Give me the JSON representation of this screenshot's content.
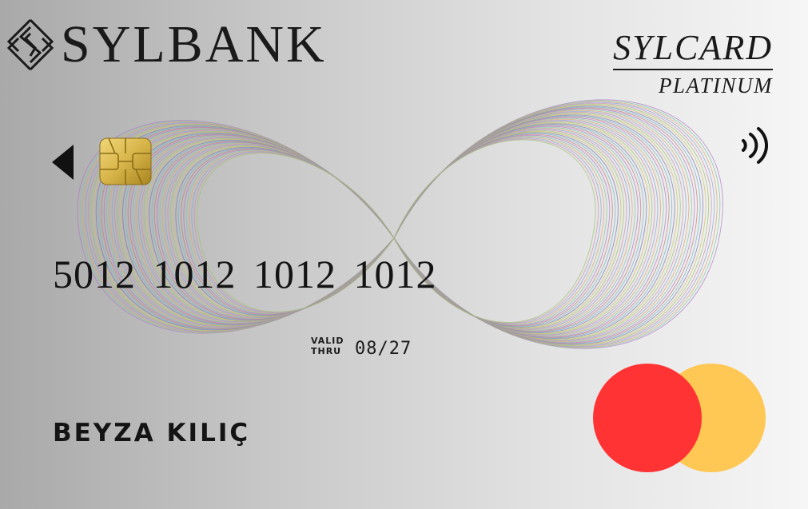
{
  "bank": {
    "name": "SYLBANK",
    "logo_icon": "diamond-s-monogram-icon"
  },
  "product": {
    "name": "SYLCARD",
    "tier": "PLATINUM"
  },
  "card": {
    "number": "5012 1012 1012 1012",
    "valid_line1": "VALID",
    "valid_line2": "THRU",
    "expiry": "08/27",
    "holder_name": "BEYZA KILIÇ"
  },
  "icons": {
    "arrow": "left-triangle-icon",
    "chip": "emv-chip-icon",
    "contactless": "contactless-icon",
    "network": "two-overlapping-circles-icon"
  },
  "colors": {
    "network_left": "#ff3333",
    "network_right": "#ffc753",
    "chip_gold": "#d8b54a",
    "text": "#141414"
  }
}
